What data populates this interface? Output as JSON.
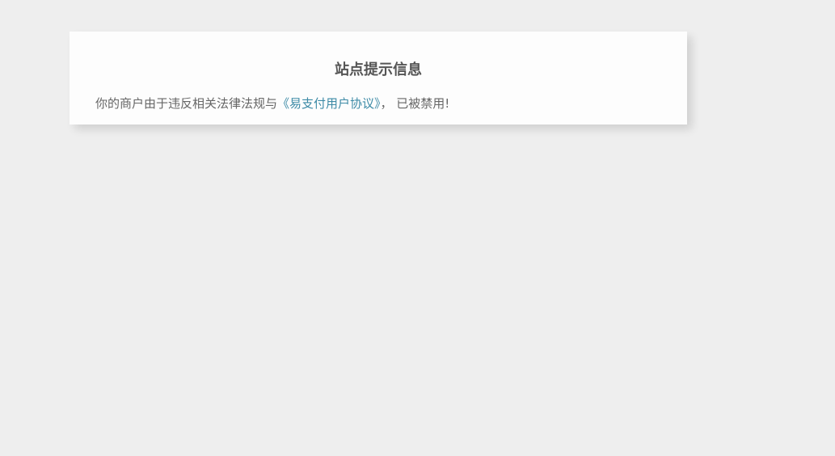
{
  "notice": {
    "title": "站点提示信息",
    "message_prefix": "你的商户由于违反相关法律法规与",
    "link_text": "《易支付用户协议》",
    "message_suffix": "， 已被禁用!"
  },
  "colors": {
    "background": "#eeeeee",
    "card": "#fdfdfd",
    "title_text": "#555555",
    "body_text": "#666666",
    "link": "#3c8aa6"
  }
}
